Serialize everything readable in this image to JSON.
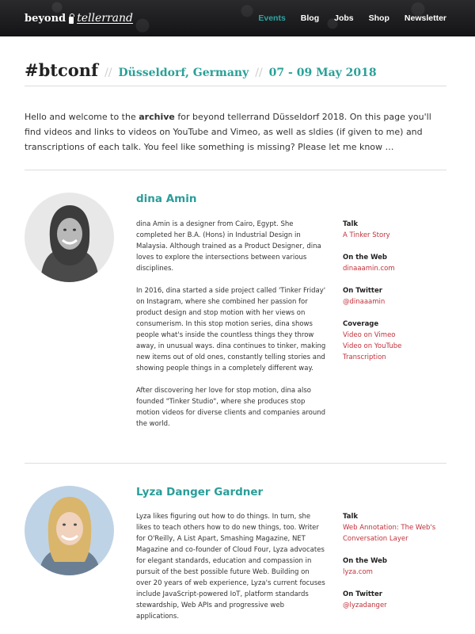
{
  "header": {
    "logo_first": "beyond",
    "logo_second": "tellerrand",
    "nav": [
      "Events",
      "Blog",
      "Jobs",
      "Shop",
      "Newsletter"
    ]
  },
  "title": {
    "hashtag": "#btconf",
    "separator": "//",
    "location": "Düsseldorf, Germany",
    "dates": "07 - 09 May 2018"
  },
  "intro": {
    "part1": "Hello and welcome to the ",
    "bold": "archive",
    "part2": " for beyond tellerrand Düsseldorf 2018. On this page you'll find videos and links to videos on YouTube and Vimeo, as well as sldies (if given to me) and transcriptions of each talk. You feel like something is missing? Please let me know …"
  },
  "speakers": [
    {
      "name": "dina Amin",
      "bio": [
        "dina Amin is a designer from Cairo, Egypt. She completed her B.A. (Hons) in Industrial Design in Malaysia. Although trained as a Product Designer, dina loves to explore the intersections between various disciplines.",
        "In 2016, dina started a side project called 'Tinker Friday' on Instagram, where she combined her passion for product design and stop motion with her views on consumerism. In this stop motion series, dina shows people what's inside the countless things they throw away, in unusual ways. dina continues to tinker, making new items out of old ones, constantly telling stories and showing people things in a completely different way.",
        "After discovering her love for stop motion, dina also founded \"Tinker Studio\", where she produces stop motion videos for diverse clients and companies around the world."
      ],
      "talk_label": "Talk",
      "talk": "A Tinker Story",
      "web_label": "On the Web",
      "web": "dinaaamin.com",
      "twitter_label": "On Twitter",
      "twitter": "@dinaaamin",
      "coverage_label": "Coverage",
      "coverage": [
        "Video on Vimeo",
        "Video on YouTube",
        "Transcription"
      ]
    },
    {
      "name": "Lyza Danger Gardner",
      "bio": [
        "Lyza likes figuring out how to do things. In turn, she likes to teach others how to do new things, too. Writer for O'Reilly, A List Apart, Smashing Magazine, NET Magazine and co-founder of Cloud Four, Lyza advocates for elegant standards, education and compassion in pursuit of the best possible future Web. Building on over 20 years of web experience, Lyza's current focuses include JavaScript-powered IoT, platform standards stewardship, Web APIs and progressive web applications."
      ],
      "talk_label": "Talk",
      "talk": "Web Annotation: The Web's Conversation Layer",
      "web_label": "On the Web",
      "web": "lyza.com",
      "twitter_label": "On Twitter",
      "twitter": "@lyzadanger"
    }
  ],
  "colors": {
    "accent": "#2aa198",
    "link": "#c2313a",
    "header_bg": "#1d1d1f"
  }
}
